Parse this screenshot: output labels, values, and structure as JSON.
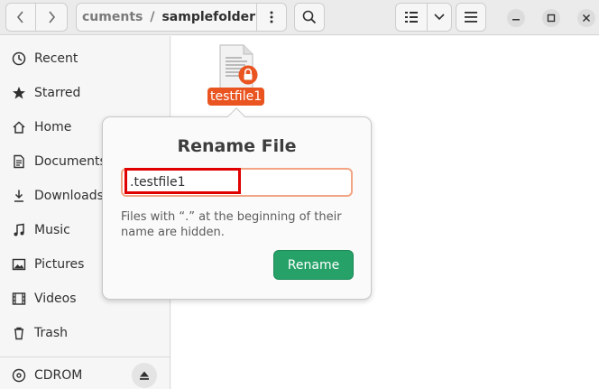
{
  "pathbar": {
    "previous_crumb": "cuments",
    "separator": "/",
    "current_folder": "samplefolder"
  },
  "sidebar": {
    "items": [
      {
        "label": "Recent",
        "icon": "clock-icon"
      },
      {
        "label": "Starred",
        "icon": "star-icon"
      },
      {
        "label": "Home",
        "icon": "home-icon"
      },
      {
        "label": "Documents",
        "icon": "document-icon"
      },
      {
        "label": "Downloads",
        "icon": "download-icon"
      },
      {
        "label": "Music",
        "icon": "music-icon"
      },
      {
        "label": "Pictures",
        "icon": "pictures-icon"
      },
      {
        "label": "Videos",
        "icon": "videos-icon"
      },
      {
        "label": "Trash",
        "icon": "trash-icon"
      }
    ],
    "devices": [
      {
        "label": "CDROM",
        "icon": "disc-icon"
      }
    ]
  },
  "files": [
    {
      "name": "testfile1",
      "icon": "text-file-icon",
      "badge": "lock-icon",
      "selected": true
    }
  ],
  "rename_popover": {
    "title": "Rename File",
    "entry_value": ".testfile1",
    "hint": "Files with “.” at the beginning of their name are hidden.",
    "button_label": "Rename"
  },
  "colors": {
    "accent": "#e95420",
    "rename_button": "#26a269",
    "highlight_box": "#e00000"
  }
}
